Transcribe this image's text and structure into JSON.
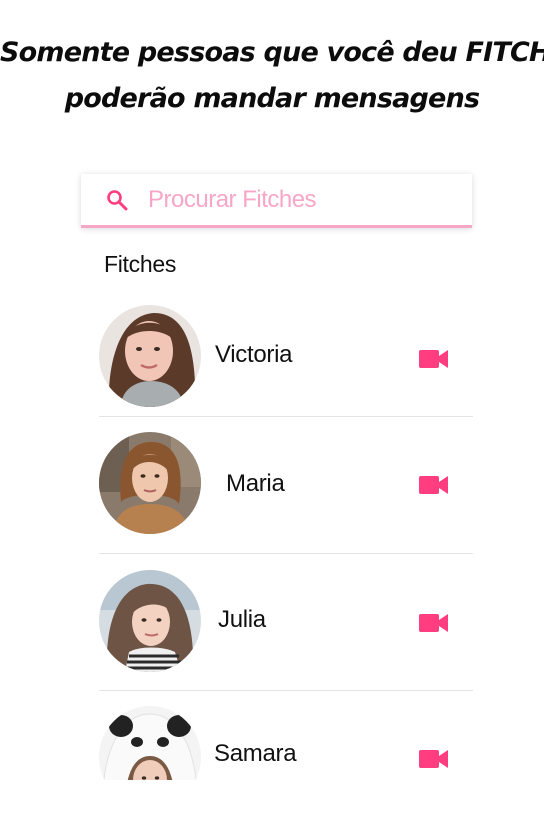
{
  "headline": {
    "line1": "Somente pessoas que você deu FITCH",
    "line2": "poderão mandar mensagens"
  },
  "search": {
    "placeholder": "Procurar Fitches",
    "icon": "search-icon"
  },
  "section_title": "Fitches",
  "contacts": [
    {
      "name": "Victoria",
      "icon": "video-camera-icon"
    },
    {
      "name": "Maria",
      "icon": "video-camera-icon"
    },
    {
      "name": "Julia",
      "icon": "video-camera-icon"
    },
    {
      "name": "Samara",
      "icon": "video-camera-icon"
    }
  ],
  "colors": {
    "accent": "#ff3d7f",
    "accent_light": "#f7a6c8",
    "divider": "#e4e4e4"
  }
}
